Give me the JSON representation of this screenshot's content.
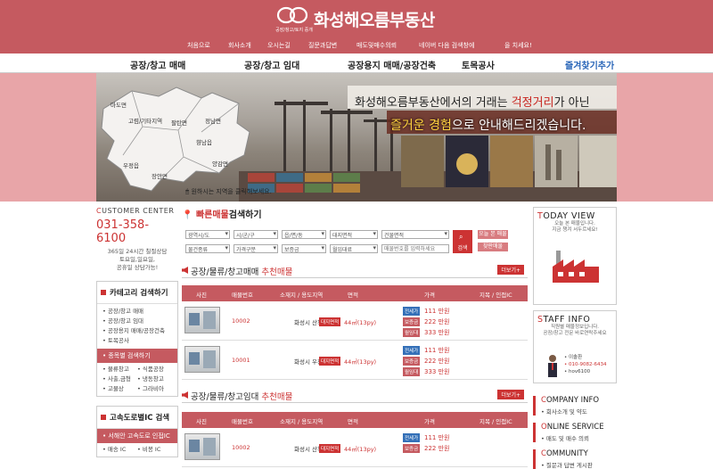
{
  "brand": {
    "name": "화성해오름부동산",
    "tagline": "공장/창고/토지 중개"
  },
  "top_nav": [
    "처음으로",
    "회사소개",
    "오시는길",
    "질문과답변",
    "매도및매수의뢰",
    "네이버 다음 검색창에",
    "을 치세요!"
  ],
  "main_nav": [
    "공장/창고 매매",
    "공장/창고 임대",
    "공장용지 매매/공장건축",
    "토목공사",
    "즐겨찾기추가"
  ],
  "banner": {
    "line1_pre": "화성해오름부동산에서의 거래는 ",
    "line1_hl": "걱정거리",
    "line1_post": "가 아닌",
    "line2_hl": "즐거운 경험",
    "line2_post": "으로 안내해드리겠습니다.",
    "map_regions": [
      "마도면",
      "고렴/기타지역",
      "팔탄면",
      "정남면",
      "향남읍",
      "우정읍",
      "장안면",
      "양감면"
    ],
    "map_hint": "원하시는 지역을 클릭해보세요."
  },
  "customer_center": {
    "title_first": "C",
    "title_rest": "USTOMER CENTER",
    "phone": "031-358-6100",
    "note1": "365일 24시간 칠절상담",
    "note2": "토요일,일요일,",
    "note3": "공휴일 상담가능!"
  },
  "category": {
    "title": "카테고리 검색하기",
    "items": [
      "공장/창고 매매",
      "공장/창고 임대",
      "공장용지 매매/공장건축",
      "토목공사"
    ],
    "sub_title": "종목별 검색하기",
    "sub_items": [
      "물류창고",
      "식품공장",
      "사출,금형",
      "냉동창고",
      "고물상",
      "그라비아"
    ]
  },
  "highway": {
    "title": "고속도로별IC 검색",
    "sub": "서해안 고속도로 인접IC",
    "items": [
      "매송 IC",
      "비봉 IC"
    ]
  },
  "quick_search": {
    "title_hl": "빠른매물",
    "title_rest": "검색하기",
    "selects": [
      "광역시/도",
      "시/군/구",
      "읍/면/동",
      "대지면적",
      "건물면적",
      "물건종류",
      "가격구분",
      "보증금",
      "월임대료"
    ],
    "input_placeholder": "매물번호를 입력하세요",
    "search_label": "검색",
    "btn_today": "오늘 본 매물",
    "btn_request": "찾판매물"
  },
  "section1": {
    "title_pre": "공장/물류/창고매매 ",
    "title_hl": "추천매물",
    "more": "더보기+"
  },
  "section2": {
    "title_pre": "공장/물류/창고임대 ",
    "title_hl": "추천매물",
    "more": "더보기+"
  },
  "table_headers": [
    "사진",
    "매물번호",
    "소재지 / 용도지역",
    "면적",
    "가격",
    "지목 / 인접IC"
  ],
  "listings1": [
    {
      "no": "10002",
      "loc": "화성시 산척동",
      "tag": "대지면적",
      "area": "44㎡(13py)",
      "price_tags": [
        "전세가",
        "보증금",
        "월임대"
      ],
      "prices": [
        "111 만원",
        "222 만원",
        "333 만원"
      ]
    },
    {
      "no": "10001",
      "loc": "화성시 우정읍",
      "tag": "대지면적",
      "area": "44㎡(13py)",
      "price_tags": [
        "전세가",
        "보증금",
        "월임대"
      ],
      "prices": [
        "111 만원",
        "222 만원",
        "333 만원"
      ]
    }
  ],
  "listings2": [
    {
      "no": "10002",
      "loc": "화성시 산척동",
      "tag": "대지면적",
      "area": "44㎡(13py)",
      "price_tags": [
        "전세가",
        "보증금"
      ],
      "prices": [
        "111 만원",
        "222 만원"
      ]
    }
  ],
  "today_view": {
    "title_first": "T",
    "title_rest": "ODAY VIEW",
    "note1": "오늘 본 매물입니다.",
    "note2": "지금 챙겨 서두르세요!"
  },
  "staff": {
    "title_first": "S",
    "title_rest": "TAFF INFO",
    "note1": "직원별 매물정보입니다.",
    "note2": "공장/창고 전문 바로연락주세요",
    "name": "• 이솔환",
    "phone": "• 010-9082-6434",
    "id": "• hov6100"
  },
  "company": {
    "title_first": "C",
    "title_rest": "OMPANY INFO",
    "sub": "• 회사소개 및 약도"
  },
  "online": {
    "title_first": "O",
    "title_rest": "NLINE SERVICE",
    "sub": "• 매도 및 매수 의뢰"
  },
  "community": {
    "title_first": "C",
    "title_rest": "OMMUNITY",
    "sub": "• 질문과 답변 게시판"
  },
  "colors": {
    "brand": "#c55a60",
    "accent": "#c33",
    "banner_side": "#e8a5a8",
    "link_blue": "#2a66b8"
  }
}
